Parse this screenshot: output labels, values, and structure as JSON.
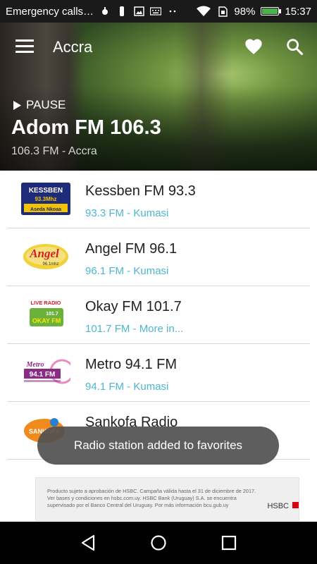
{
  "status_bar": {
    "notification_text": "Emergency calls…",
    "battery_percent": "98%",
    "time": "15:37"
  },
  "header": {
    "location": "Accra",
    "play_state": "PAUSE",
    "now_playing_title": "Adom FM 106.3",
    "now_playing_subtitle": "106.3 FM - Accra"
  },
  "stations": [
    {
      "name": "Kessben FM 93.3",
      "detail": "93.3 FM - Kumasi",
      "logo_text": "KESSBEN",
      "logo_sub": "93.3Mhz",
      "logo_tag": "Aseda Nkoaa"
    },
    {
      "name": "Angel FM 96.1",
      "detail": "96.1 FM - Kumasi",
      "logo_text": "Angel",
      "logo_sub": "96.1mhz"
    },
    {
      "name": "Okay FM 101.7",
      "detail": "101.7 FM - More in...",
      "logo_text": "LIVE RADIO",
      "logo_sub": "101.7",
      "logo_tag": "OKAY FM"
    },
    {
      "name": "Metro 94.1 FM",
      "detail": "94.1 FM - Kumasi",
      "logo_text": "Metro",
      "logo_sub": "94.1 FM"
    },
    {
      "name": "Sankofa Radio",
      "detail": "",
      "logo_text": "SANKOFA"
    }
  ],
  "toast": "Radio station added to favorites",
  "ad": {
    "text": "Producto sujeto a aprobación de HSBC. Campaña válida hasta el 31 de diciembre de 2017. Ver bases y condiciones en hsbc.com.uy. HSBC Bank (Uruguay) S.A. se encuentra supervisado por el Banco Central del Uruguay. Por más información bcu.gub.uy",
    "brand": "HSBC"
  },
  "colors": {
    "accent_subtitle": "#4cb7d1",
    "toast_bg": "#505050"
  }
}
